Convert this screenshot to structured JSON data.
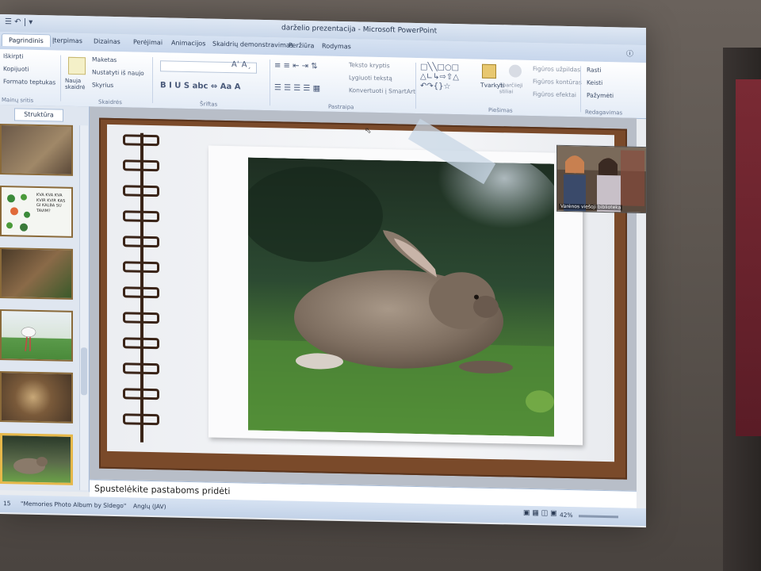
{
  "window": {
    "title": "darželio prezentacija - Microsoft PowerPoint",
    "qat": "☰ ↶ | ▾"
  },
  "tabs": [
    {
      "label": "Pagrindinis",
      "active": true
    },
    {
      "label": "Įterpimas"
    },
    {
      "label": "Dizainas"
    },
    {
      "label": "Perėjimai"
    },
    {
      "label": "Animacijos"
    },
    {
      "label": "Skaidrių demonstravimas"
    },
    {
      "label": "Peržiūra"
    },
    {
      "label": "Rodymas"
    }
  ],
  "ribbon": {
    "clipboard": {
      "cut": "Iškirpti",
      "copy": "Kopijuoti",
      "format": "Formato teptukas",
      "group": "Mainų sritis"
    },
    "slides": {
      "new_slide": "Nauja skaidrė",
      "layout": "Maketas",
      "reset": "Nustatyti iš naujo",
      "section": "Skyrius",
      "group": "Skaidrės"
    },
    "font": {
      "group": "Šriftas"
    },
    "paragraph": {
      "text_direction": "Teksto kryptis",
      "align_text": "Lygiuoti tekstą",
      "convert": "Konvertuoti į SmartArt",
      "group": "Pastraipa"
    },
    "drawing": {
      "arrange": "Tvarkyti",
      "quick_styles": "Sparčiieji stiliai",
      "fill": "Figūros užpildas",
      "outline": "Figūros kontūras",
      "effects": "Figūros efektai",
      "group": "Piešimas"
    },
    "editing": {
      "find": "Rasti",
      "replace": "Keisti",
      "select": "Pažymėti",
      "group": "Redagavimas"
    }
  },
  "left_panel": {
    "tab_label": "Struktūra",
    "slide2_text": "KVA KVA KVA KVIR KVIR KAS GI KALBA SU TAVIM?"
  },
  "notes": {
    "placeholder": "Spustelėkite pastaboms pridėti"
  },
  "status": {
    "slide_num": "15",
    "theme": "\"Memories Photo Album by Sldego\"",
    "language": "Anglų (JAV)",
    "zoom": "42%"
  },
  "video_overlay": {
    "label": "Varėnos viešoji biblioteka"
  }
}
